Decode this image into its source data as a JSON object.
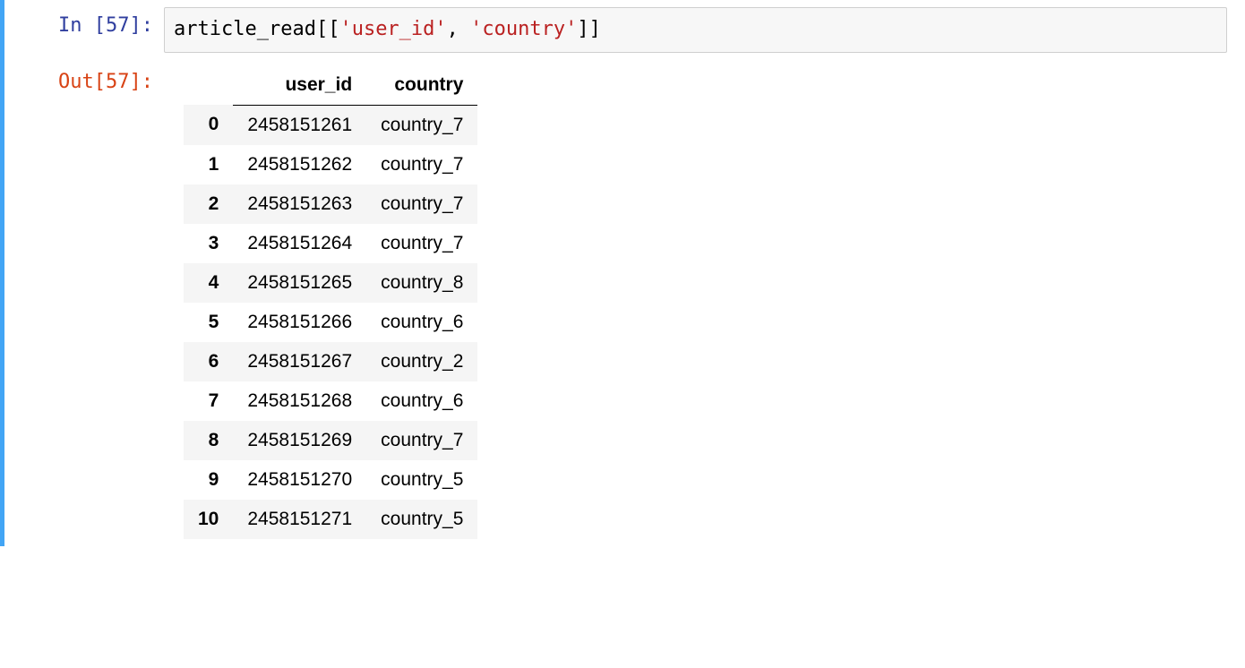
{
  "cell": {
    "in_label": "In [57]:",
    "out_label": "Out[57]:",
    "code": {
      "var": "article_read",
      "open": "[[",
      "str1": "'user_id'",
      "comma": ", ",
      "str2": "'country'",
      "close": "]]"
    },
    "dataframe": {
      "columns": [
        "user_id",
        "country"
      ],
      "index": [
        "0",
        "1",
        "2",
        "3",
        "4",
        "5",
        "6",
        "7",
        "8",
        "9",
        "10"
      ],
      "rows": [
        [
          "2458151261",
          "country_7"
        ],
        [
          "2458151262",
          "country_7"
        ],
        [
          "2458151263",
          "country_7"
        ],
        [
          "2458151264",
          "country_7"
        ],
        [
          "2458151265",
          "country_8"
        ],
        [
          "2458151266",
          "country_6"
        ],
        [
          "2458151267",
          "country_2"
        ],
        [
          "2458151268",
          "country_6"
        ],
        [
          "2458151269",
          "country_7"
        ],
        [
          "2458151270",
          "country_5"
        ],
        [
          "2458151271",
          "country_5"
        ]
      ]
    }
  }
}
